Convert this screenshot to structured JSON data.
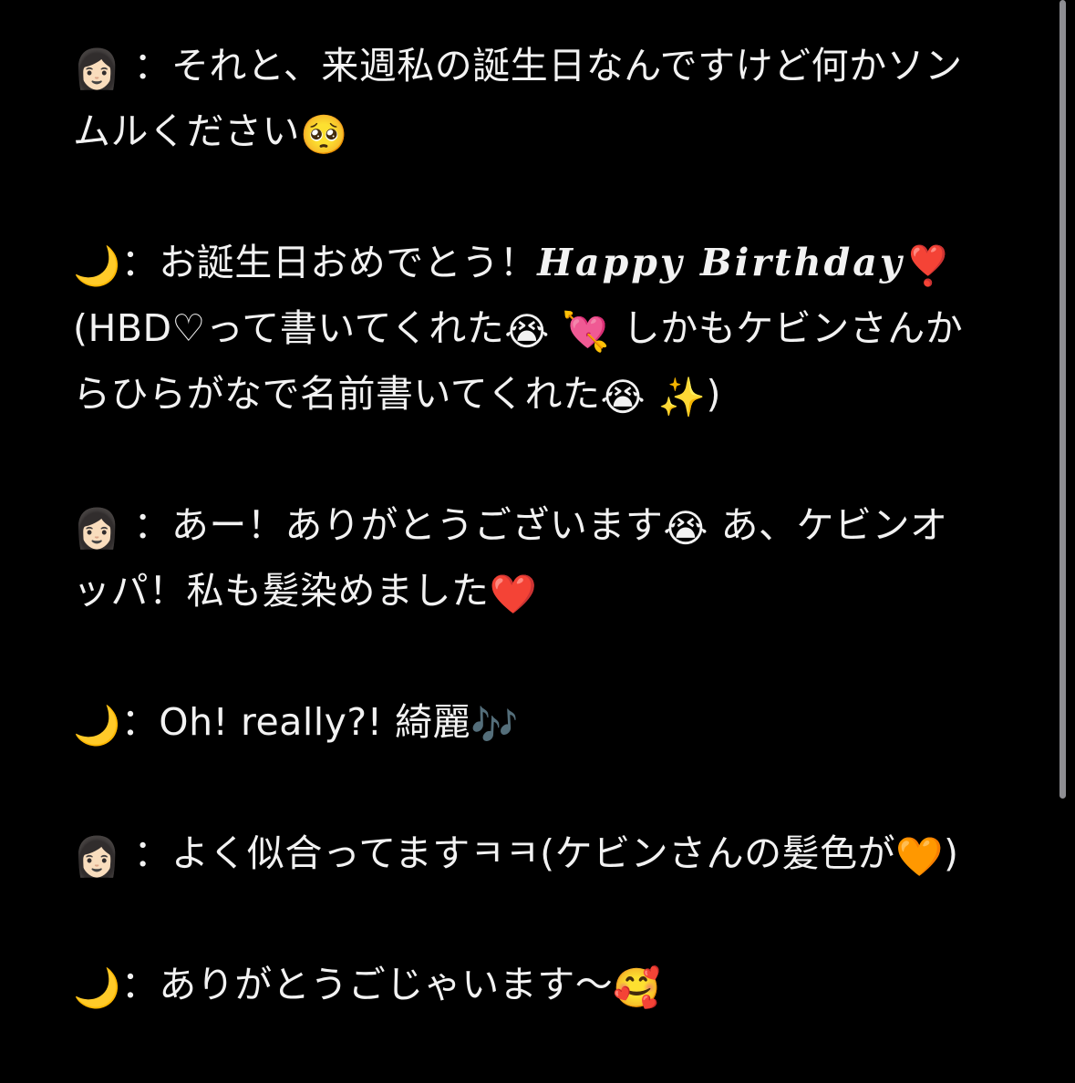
{
  "speakers": {
    "me": {
      "icon": "woman-light-skin-emoji",
      "glyph": "👩🏻"
    },
    "moon": {
      "icon": "crescent-moon-emoji",
      "glyph": "🌙"
    }
  },
  "messages": [
    {
      "line1": "：それと、来週私の誕生日なんですけど何かソン",
      "line2_text": "ムルください",
      "line2_emoji": "🥺"
    },
    {
      "line1_text": "：お誕生日おめでとう！",
      "line1_fancy": "Happy Birthday",
      "line1_emoji": "❣️",
      "line2_a": "(HBD♡って書いてくれた",
      "line2_emoji_a": "😭",
      "line2_emoji_b": "💘",
      "line2_b": "しかもケビンさんか",
      "line3_a": "らひらがなで名前書いてくれた",
      "line3_emoji_a": "😭",
      "line3_emoji_b": "✨",
      "line3_b": ")"
    },
    {
      "line1_a": "：あー！ありがとうございます",
      "line1_emoji": "😭",
      "line1_b": " あ、ケビンオ",
      "line2_text": "ッパ！私も髪染めました",
      "line2_emoji": "❤️"
    },
    {
      "line1_text": "：Oh! really?! 綺麗",
      "line1_emoji": "🎶"
    },
    {
      "line1_a": "：よく似合ってますㅋㅋ(ケビンさんの髪色が",
      "line1_emoji": "🧡",
      "line1_b": ")"
    },
    {
      "line1_text": "：ありがとうごじゃいます〜",
      "line1_emoji": "🥰"
    }
  ]
}
